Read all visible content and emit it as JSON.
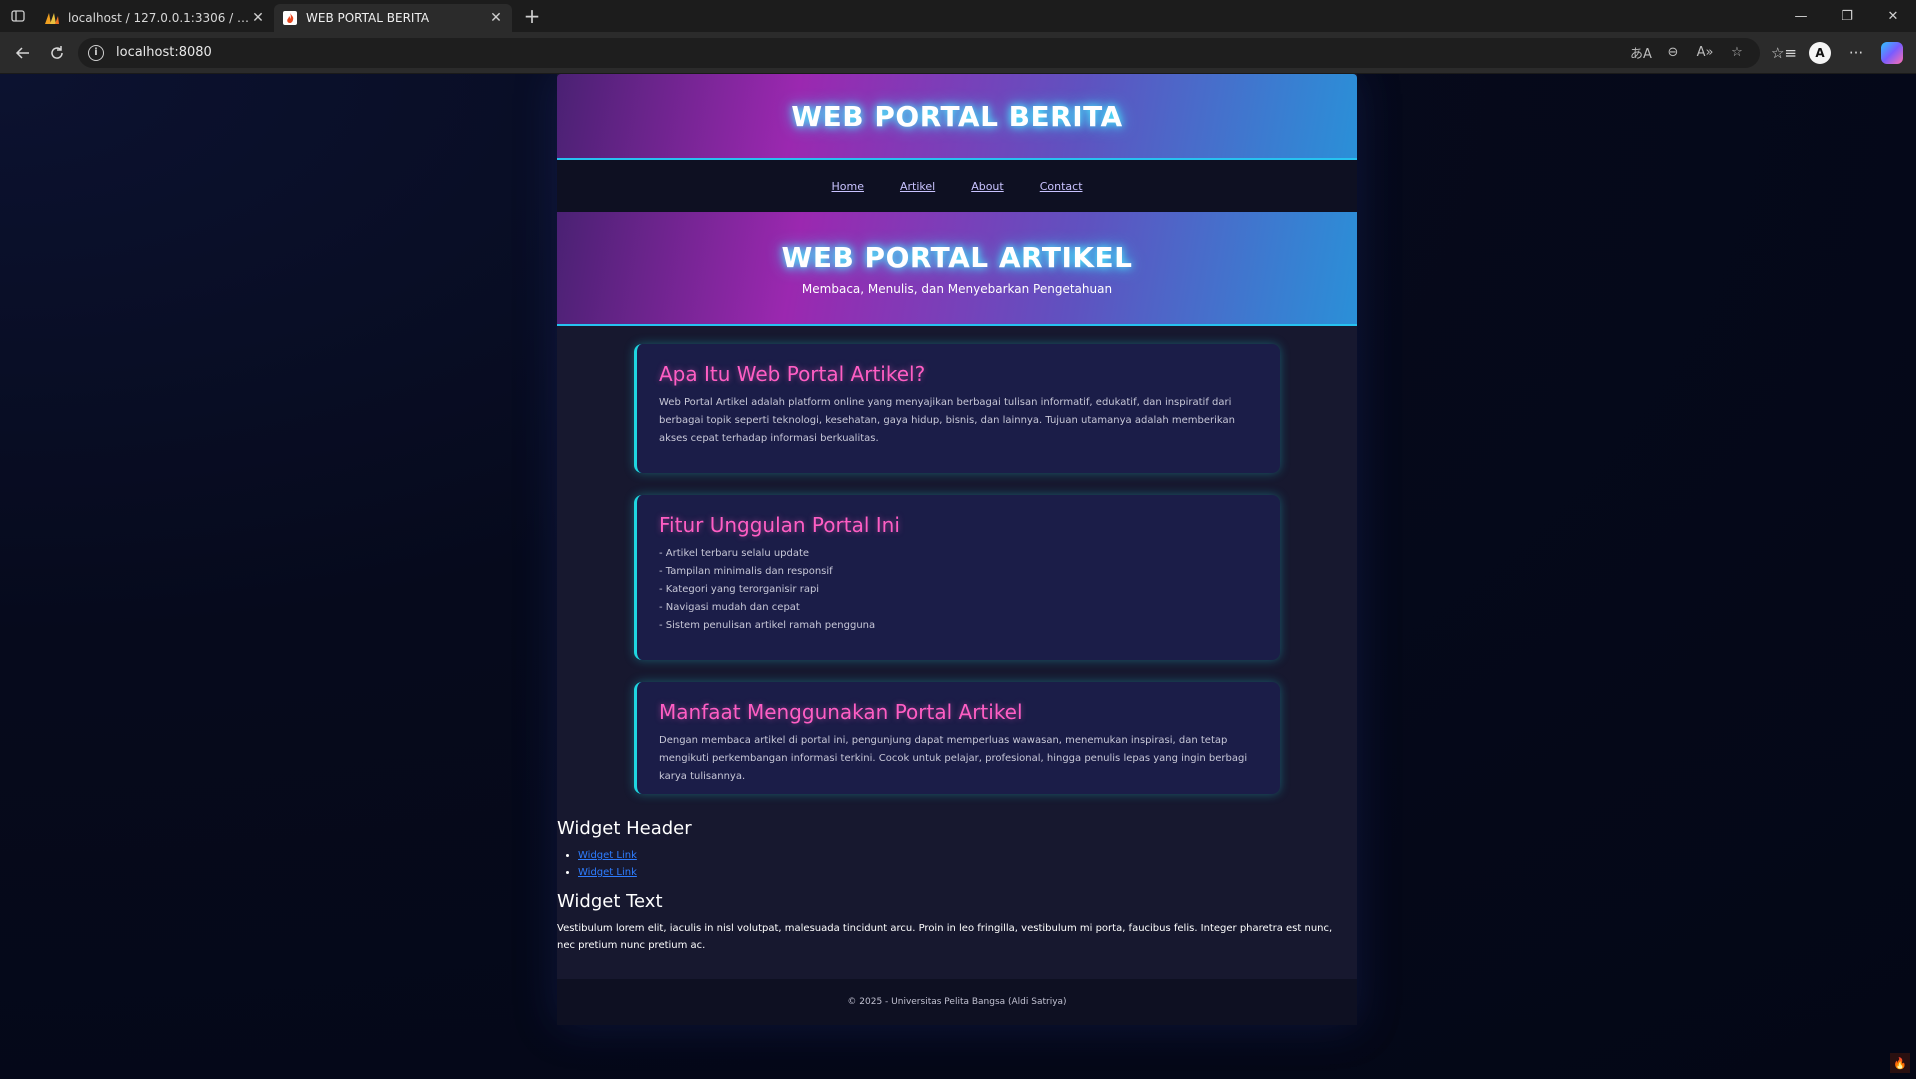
{
  "browser": {
    "tabs": [
      {
        "title": "localhost / 127.0.0.1:3306 / invent",
        "icon": "phpmyadmin-icon",
        "active": false
      },
      {
        "title": "WEB PORTAL BERITA",
        "icon": "codeigniter-icon",
        "active": true
      }
    ],
    "url": "localhost:8080"
  },
  "site": {
    "header_title": "WEB PORTAL BERITA",
    "nav": [
      "Home",
      "Artikel",
      "About",
      "Contact"
    ],
    "hero": {
      "title": "WEB PORTAL ARTIKEL",
      "subtitle": "Membaca, Menulis, dan Menyebarkan Pengetahuan"
    },
    "cards": [
      {
        "title": "Apa Itu Web Portal Artikel?",
        "body": "Web Portal Artikel adalah platform online yang menyajikan berbagai tulisan informatif, edukatif, dan inspiratif dari berbagai topik seperti teknologi, kesehatan, gaya hidup, bisnis, dan lainnya. Tujuan utamanya adalah memberikan akses cepat terhadap informasi berkualitas."
      },
      {
        "title": "Fitur Unggulan Portal Ini",
        "items": [
          "- Artikel terbaru selalu update",
          "- Tampilan minimalis dan responsif",
          "- Kategori yang terorganisir rapi",
          "- Navigasi mudah dan cepat",
          "- Sistem penulisan artikel ramah pengguna"
        ]
      },
      {
        "title": "Manfaat Menggunakan Portal Artikel",
        "body": "Dengan membaca artikel di portal ini, pengunjung dapat memperluas wawasan, menemukan inspirasi, dan tetap mengikuti perkembangan informasi terkini. Cocok untuk pelajar, profesional, hingga penulis lepas yang ingin berbagi karya tulisannya."
      }
    ],
    "widget_header": {
      "title": "Widget Header",
      "links": [
        "Widget Link",
        "Widget Link"
      ]
    },
    "widget_text": {
      "title": "Widget Text",
      "body": "Vestibulum lorem elit, iaculis in nisl volutpat, malesuada tincidunt arcu. Proin in leo fringilla, vestibulum mi porta, faucibus felis. Integer pharetra est nunc, nec pretium nunc pretium ac."
    },
    "footer": "© 2025 - Universitas Pelita Bangsa (Aldi Satriya)"
  },
  "colors": {
    "accent_cyan": "#1fd6e0",
    "heading_pink": "#ff5ec4",
    "link_blue": "#2e7dff"
  }
}
